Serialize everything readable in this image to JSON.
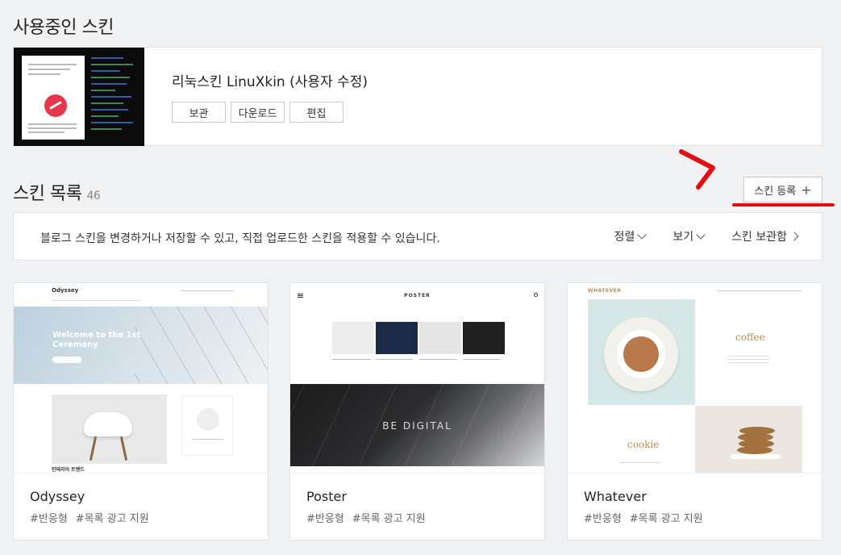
{
  "current": {
    "heading": "사용중인 스킨",
    "skin_name": "리눅스킨 LinuXkin (사용자 수정)",
    "buttons": [
      "보관",
      "다운로드",
      "편집"
    ]
  },
  "list": {
    "heading": "스킨 목록",
    "count": "46",
    "register_label": "스킨 등록",
    "register_icon": "plus-icon",
    "highlight_color": "#e30e12"
  },
  "info": {
    "text": "블로그 스킨을 변경하거나 저장할 수 있고, 직접 업로드한 스킨을 적용할 수 있습니다.",
    "sort_label": "정렬",
    "view_label": "보기",
    "storage_label": "스킨 보관함"
  },
  "skins": [
    {
      "name": "Odyssey",
      "tags": [
        "#반응형",
        "#목록 광고 지원"
      ],
      "preview": {
        "brand": "Odyssey",
        "hero": "Welcome to the 1st Ceremony",
        "section": "인테리어 트렌드"
      }
    },
    {
      "name": "Poster",
      "tags": [
        "#반응형",
        "#목록 광고 지원"
      ],
      "preview": {
        "brand": "POSTER",
        "banner": "BE DIGITAL"
      }
    },
    {
      "name": "Whatever",
      "tags": [
        "#반응형",
        "#목록 광고 지원"
      ],
      "preview": {
        "brand": "WHATEVER",
        "word1": "coffee",
        "word2": "cookie"
      }
    }
  ]
}
